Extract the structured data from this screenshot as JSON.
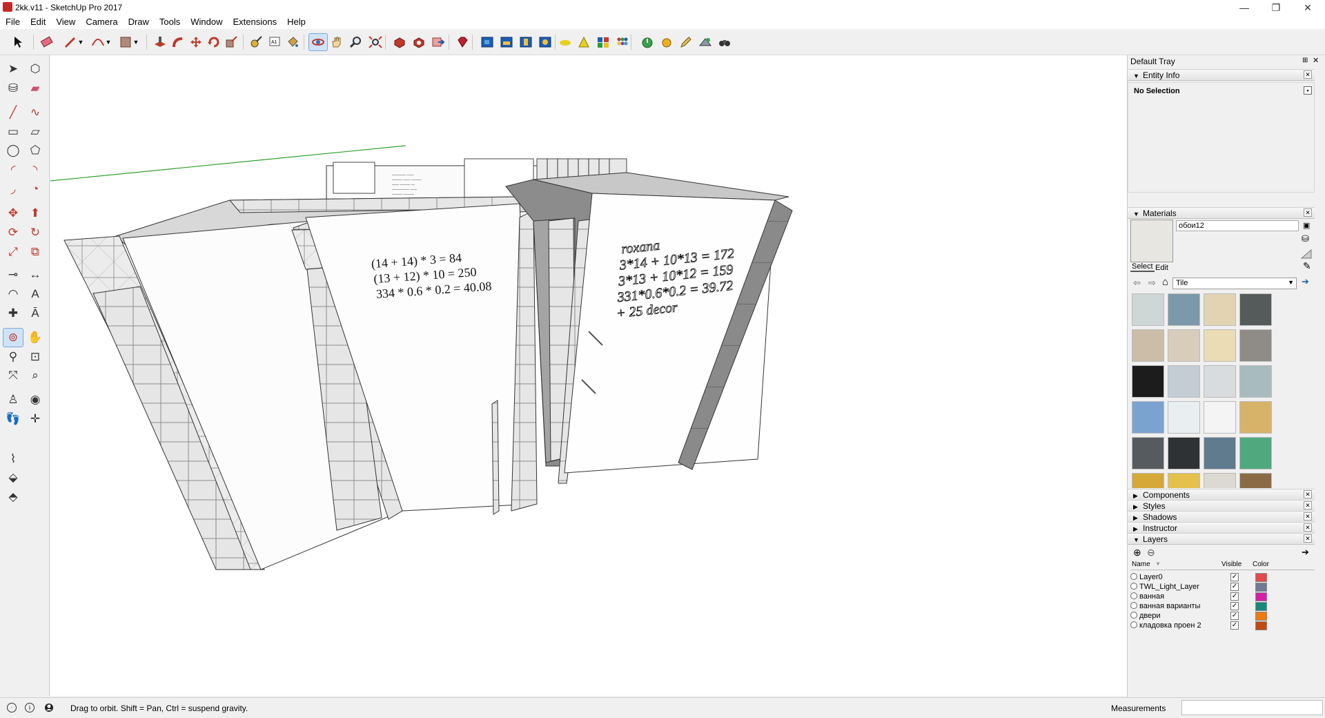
{
  "window": {
    "title": "2kk.v11 - SketchUp Pro 2017",
    "minimize": "—",
    "restore": "❐",
    "close": "✕"
  },
  "menu": [
    "File",
    "Edit",
    "View",
    "Camera",
    "Draw",
    "Tools",
    "Window",
    "Extensions",
    "Help"
  ],
  "toolbar_icons": [
    "select-icon",
    "eraser-icon",
    "line-icon",
    "chevron-down-icon",
    "arc-icon",
    "chevron-down-icon",
    "rectangle-icon",
    "chevron-down-icon",
    "push-pull-icon",
    "follow-me-icon",
    "move-icon",
    "rotate-icon",
    "scale-icon",
    "tape-measure-icon",
    "text-icon",
    "paint-bucket-icon",
    "orbit-icon",
    "pan-icon",
    "zoom-icon",
    "zoom-extents-icon",
    "3d-warehouse-icon",
    "extension-warehouse-icon",
    "send-to-layout-icon",
    "ruby-icon",
    "view-iso-icon",
    "view-top-icon",
    "view-front-icon",
    "view-right-icon",
    "sandbox-icon",
    "sandbox-triangle-icon",
    "extension-grid-icon",
    "extension-dots-icon",
    "power-icon",
    "sun-icon",
    "pencil-icon",
    "camera-icon",
    "binoculars-icon"
  ],
  "left_tools": [
    "select-icon",
    "component-icon",
    "paint-bucket-icon",
    "eraser-icon",
    "line-icon",
    "freehand-icon",
    "rectangle-icon",
    "rotated-rectangle-icon",
    "circle-icon",
    "polygon-icon",
    "arc-icon",
    "arc-2pt-icon",
    "arc-3pt-icon",
    "pie-icon",
    "move-icon",
    "push-pull-icon",
    "rotate-icon",
    "follow-me-icon",
    "scale-icon",
    "offset-icon",
    "tape-measure-icon",
    "dimension-icon",
    "protractor-icon",
    "text-icon",
    "axes-icon",
    "3d-text-icon",
    "orbit-icon",
    "pan-icon",
    "zoom-icon",
    "zoom-window-icon",
    "zoom-extents-icon",
    "previous-view-icon",
    "position-camera-icon",
    "look-around-icon",
    "walk-icon",
    "section-plane-icon",
    "sandbox-smoove-icon",
    "sandbox-stamp-icon",
    "sandbox-drape-icon"
  ],
  "viewport": {
    "note_left": [
      "(14 + 14) * 3 = 84",
      "(13 + 12) * 10 = 250",
      "334 * 0.6 * 0.2 = 40.08"
    ],
    "note_right": [
      "roxana",
      "3*14 + 10*13 = 172",
      "3*13 + 10*12 = 159",
      "331*0.6*0.2 = 39.72",
      "+ 25 decor"
    ]
  },
  "tray": {
    "title": "Default Tray",
    "entity_info": {
      "label": "Entity Info",
      "selection": "No Selection"
    },
    "materials": {
      "label": "Materials",
      "name": "обои12",
      "tab_select": "Select",
      "tab_edit": "Edit",
      "collection": "Tile",
      "swatches": [
        "#cfd6d6",
        "#7c99ab",
        "#e2d3b3",
        "#555a5a",
        "#cbbda8",
        "#d8cdbb",
        "#eadcb5",
        "#8f8b86",
        "#1c1c1c",
        "#c4ccd4",
        "#d9dcde",
        "#a8bcc0",
        "#7ba3d0",
        "#e9eef0",
        "#f4f4f4",
        "#d7b36a",
        "#565b5f",
        "#2f3234",
        "#607a8e",
        "#4fa87e",
        "#d6a83a",
        "#e3c14b",
        "#dcd9d2",
        "#8b6b46",
        "#d5c8b0",
        "#b8583a",
        "#d8cfa4",
        "#e8d8cc"
      ]
    },
    "collapsed_panels": [
      "Components",
      "Styles",
      "Shadows",
      "Instructor"
    ],
    "layers": {
      "label": "Layers",
      "col_name": "Name",
      "col_visible": "Visible",
      "col_color": "Color",
      "rows": [
        {
          "name": "Layer0",
          "color": "#e8474b"
        },
        {
          "name": "TWL_Light_Layer",
          "color": "#6f7b91"
        },
        {
          "name": "ванная",
          "color": "#d81ea9"
        },
        {
          "name": "ванная варианты",
          "color": "#168a7b"
        },
        {
          "name": "двери",
          "color": "#f07a10"
        },
        {
          "name": "кладовка проен 2",
          "color": "#c14a12"
        }
      ]
    }
  },
  "status": {
    "message": "Drag to orbit. Shift = Pan, Ctrl = suspend gravity.",
    "measurements_label": "Measurements"
  }
}
